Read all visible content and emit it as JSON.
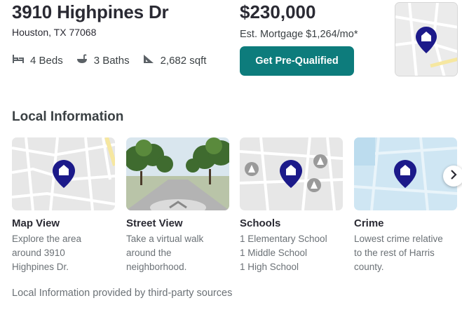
{
  "property": {
    "address": "3910 Highpines Dr",
    "city_line": "Houston, TX 77068",
    "beds": "4 Beds",
    "baths": "3 Baths",
    "sqft": "2,682 sqft",
    "price": "$230,000",
    "mortgage": "Est. Mortgage $1,264/mo*",
    "prequal_label": "Get Pre-Qualified"
  },
  "local": {
    "title": "Local Information",
    "cards": [
      {
        "title": "Map View",
        "lines": [
          "Explore the area",
          "around 3910",
          "Highpines Dr."
        ]
      },
      {
        "title": "Street View",
        "lines": [
          "Take a virtual walk",
          "around the",
          "neighborhood."
        ]
      },
      {
        "title": "Schools",
        "lines": [
          "1 Elementary School",
          "1 Middle School",
          "1 High School"
        ]
      },
      {
        "title": "Crime",
        "lines": [
          "Lowest crime relative",
          "to the rest of Harris",
          "county."
        ]
      }
    ],
    "footer": "Local Information provided by third-party sources"
  },
  "colors": {
    "brand_teal": "#0d7c7c",
    "pin_navy": "#1c1a8a",
    "crime_blue": "#cfe6f3"
  },
  "icons": [
    "bed-icon",
    "bath-icon",
    "ruler-icon",
    "location-pin-icon",
    "school-icon",
    "chevron-right-icon"
  ]
}
